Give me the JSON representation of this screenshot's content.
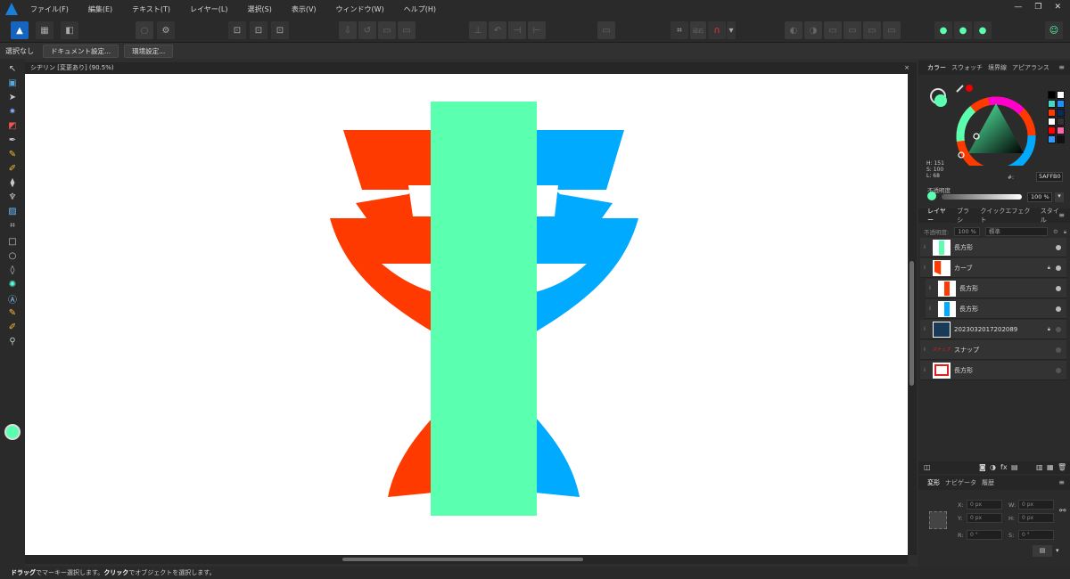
{
  "menu": {
    "items": [
      "ファイル(F)",
      "編集(E)",
      "テキスト(T)",
      "レイヤー(L)",
      "選択(S)",
      "表示(V)",
      "ウィンドウ(W)",
      "ヘルプ(H)"
    ],
    "window_controls": [
      "—",
      "❐",
      "✕"
    ]
  },
  "toolbar": {
    "snap_label": "磁石",
    "accent": "#1565c0"
  },
  "context": {
    "selection": "選択なし",
    "document_settings": "ドキュメント設定...",
    "preferences": "環境設定..."
  },
  "document": {
    "tab_title": "シヂリン [変更あり] (90.5%)",
    "close": "×"
  },
  "canvas": {
    "colors": {
      "red": "#ff3a00",
      "blue": "#00aaff",
      "green": "#5affb0"
    }
  },
  "color_panel": {
    "tabs": [
      "カラー",
      "スウォッチ",
      "境界線",
      "アピアランス"
    ],
    "hsl": [
      "H: 151",
      "S: 100",
      "L: 68"
    ],
    "hex_label": "#:",
    "hex": "5AFFB0",
    "opacity_label": "不透明度",
    "opacity": "100 %",
    "swatches": [
      "#000000",
      "#ffffff",
      "#44d7c6",
      "#1e90ff",
      "#ff3a00",
      "#0a2a5a",
      "#ffffff",
      "#333333",
      "#ff0000",
      "#ff66aa",
      "#3399ff",
      "#111111"
    ]
  },
  "layers_panel": {
    "tabs": [
      "レイヤー",
      "ブラシ",
      "クイックエフェクト",
      "スタイル"
    ],
    "opacity_label": "不透明度:",
    "opacity": "100 %",
    "blend": "標準",
    "layers": [
      {
        "name": "長方形",
        "thumb": "#5affb0",
        "kind": "rect"
      },
      {
        "name": "カーブ",
        "thumb": "#ff3a00",
        "kind": "curve"
      },
      {
        "name": "長方形",
        "thumb": "#ff3a00",
        "kind": "rect"
      },
      {
        "name": "長方形",
        "thumb": "#00aaff",
        "kind": "rect"
      },
      {
        "name": "2023032017202089",
        "thumb": "#1a3a5a",
        "kind": "image"
      },
      {
        "name": "スナップ",
        "thumb": "#e02020",
        "kind": "text"
      },
      {
        "name": "長方形",
        "thumb": "#e02020",
        "kind": "rect"
      }
    ]
  },
  "transform_panel": {
    "tabs": [
      "変形",
      "ナビゲータ",
      "履歴"
    ],
    "x_label": "X:",
    "x": "0 px",
    "y_label": "Y:",
    "y": "0 px",
    "w_label": "W:",
    "w": "0 px",
    "h_label": "H:",
    "h": "0 px",
    "r_label": "R:",
    "r": "0 °",
    "s_label": "S:",
    "s": "0 °"
  },
  "status": {
    "drag": "ドラッグ",
    "drag_text": "でマーキー選択します。",
    "click": "クリック",
    "click_text": "でオブジェクトを選択します。"
  }
}
